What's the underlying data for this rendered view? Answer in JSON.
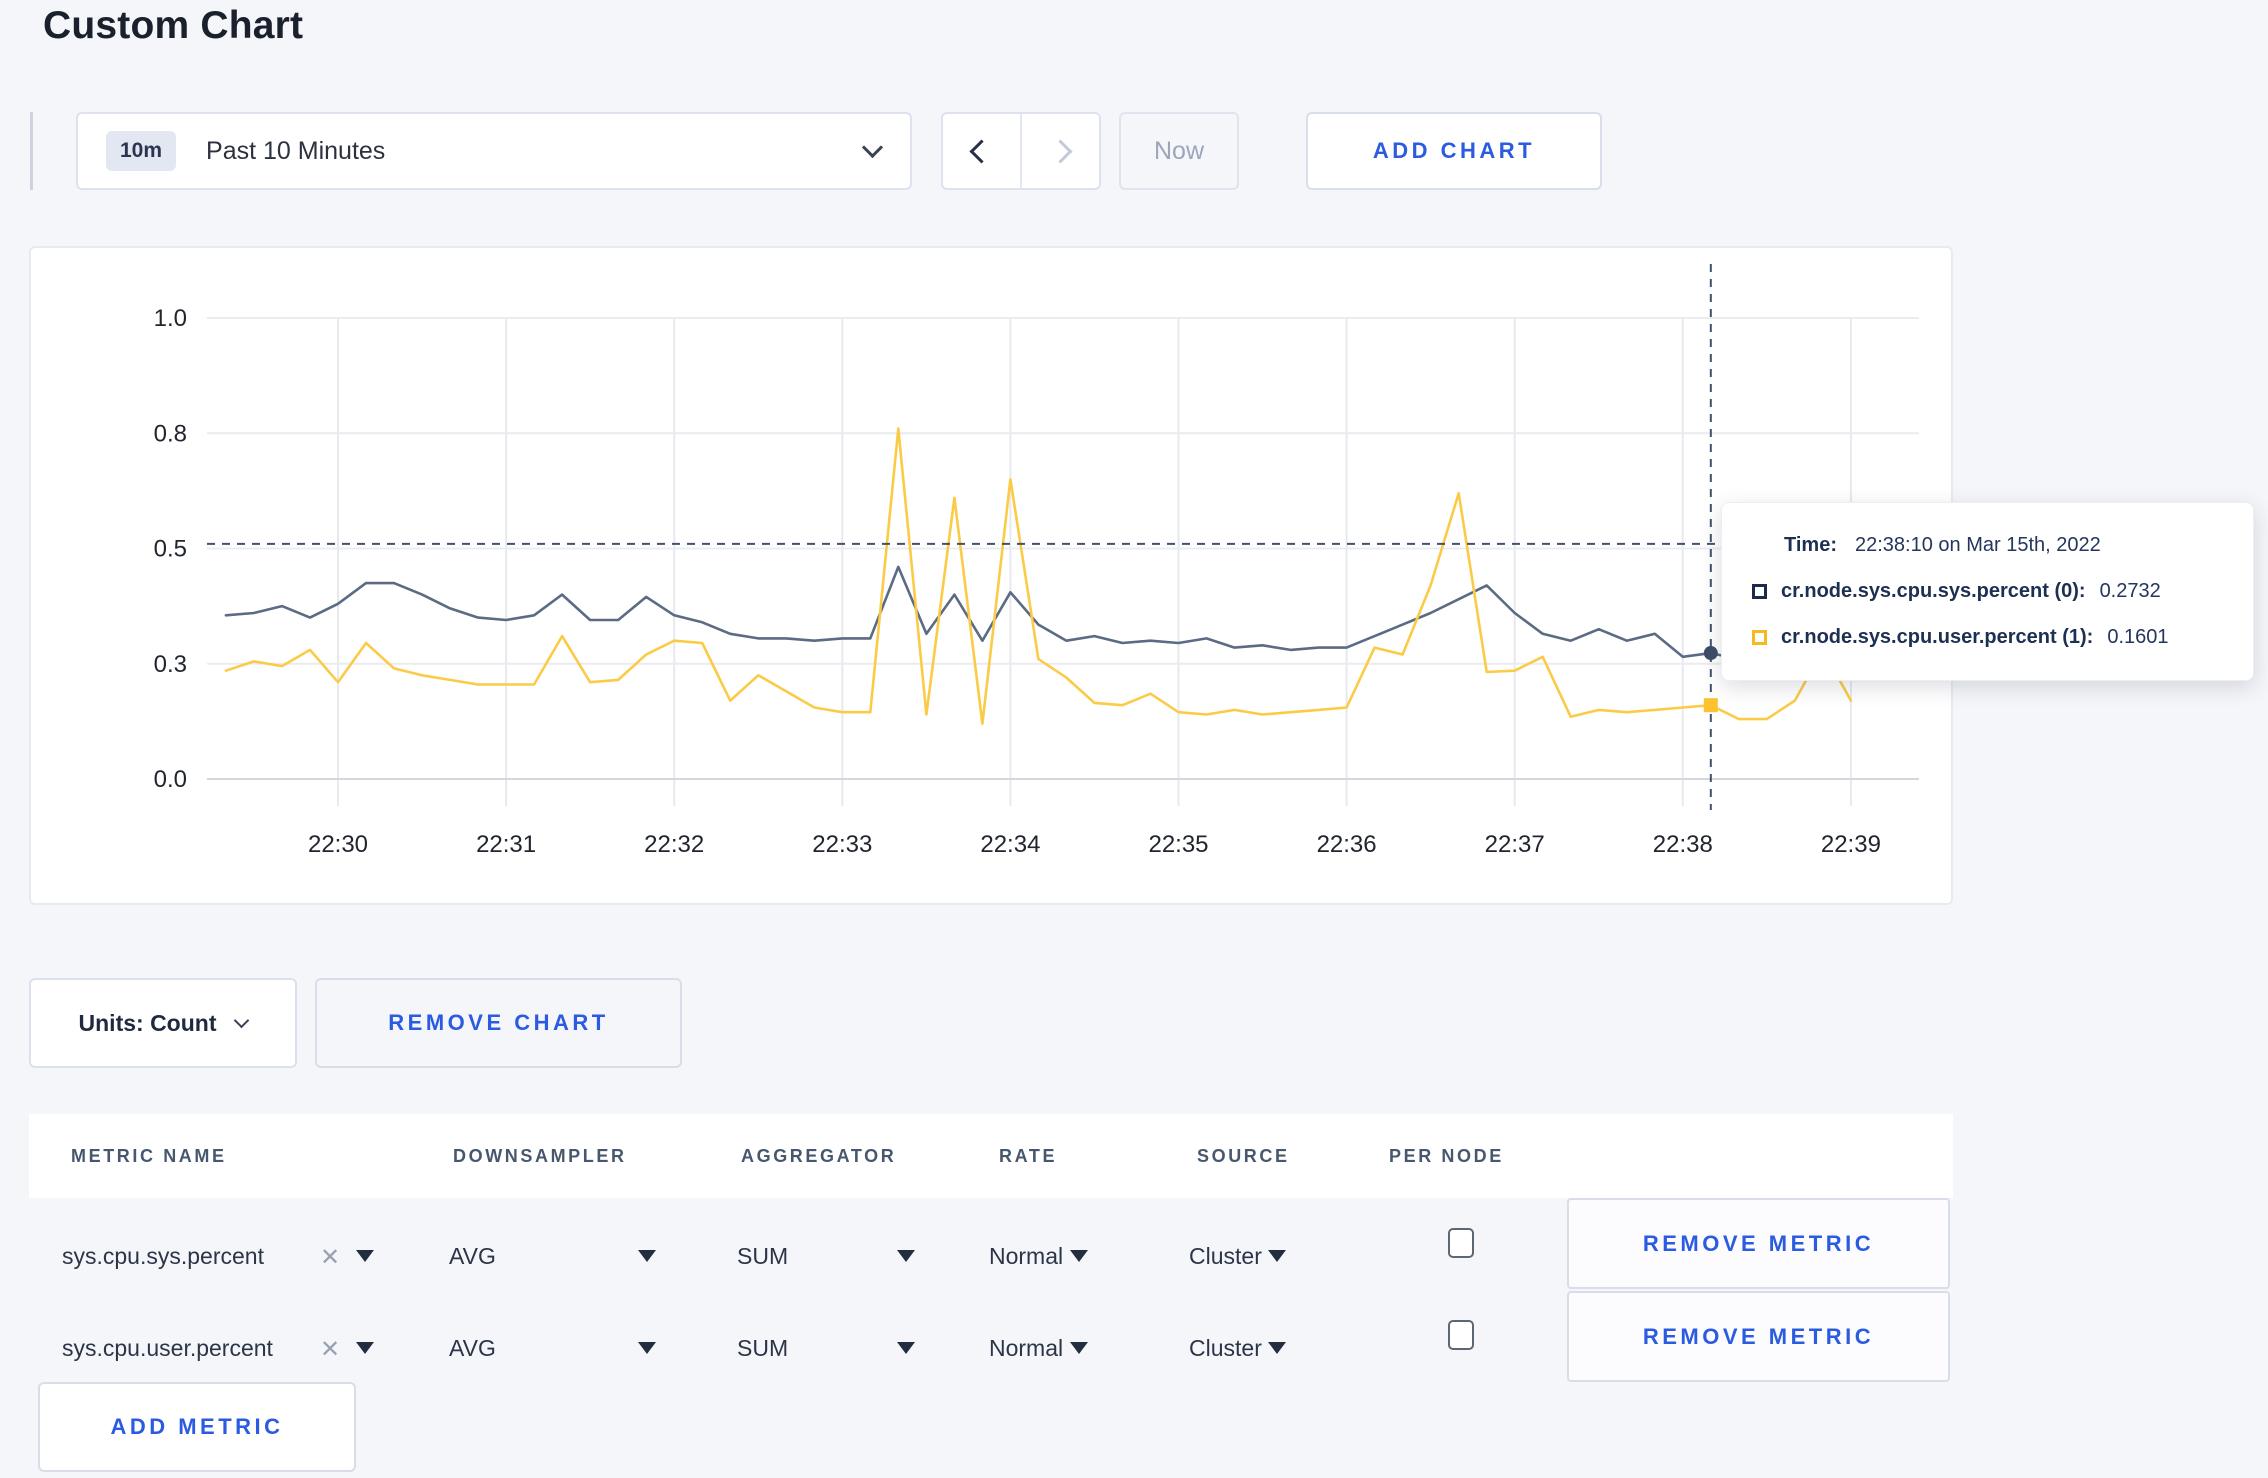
{
  "page": {
    "title": "Custom Chart",
    "background": "#f5f6fa",
    "accent_blue": "#2b5be0"
  },
  "toolbar": {
    "time_range": {
      "badge": "10m",
      "label": "Past 10 Minutes"
    },
    "now_label": "Now",
    "add_chart_label": "ADD CHART"
  },
  "chart_data": {
    "type": "line",
    "title": "",
    "xlabel": "",
    "ylabel": "",
    "ylim": [
      0,
      1
    ],
    "grid": true,
    "legend_position": "tooltip",
    "x_ticks": [
      "22:30",
      "22:31",
      "22:32",
      "22:33",
      "22:34",
      "22:35",
      "22:36",
      "22:37",
      "22:38",
      "22:39"
    ],
    "y_ticks": [
      {
        "v": 0,
        "label": "0.0"
      },
      {
        "v": 0.25,
        "label": "0.3"
      },
      {
        "v": 0.5,
        "label": "0.5"
      },
      {
        "v": 0.75,
        "label": "0.8"
      },
      {
        "v": 1,
        "label": "1.0"
      }
    ],
    "start_sec": -40,
    "step_sec": 10,
    "crosshair": {
      "index": 53,
      "time": "22:38:10",
      "hline_value": 0.51
    },
    "series": [
      {
        "name": "cr.node.sys.cpu.sys.percent (0)",
        "color": "#5b6b84",
        "marker_color": "#3e4d68",
        "values": [
          0.355,
          0.36,
          0.375,
          0.35,
          0.38,
          0.425,
          0.425,
          0.4,
          0.37,
          0.35,
          0.345,
          0.355,
          0.4,
          0.345,
          0.345,
          0.395,
          0.355,
          0.34,
          0.315,
          0.305,
          0.305,
          0.3,
          0.305,
          0.305,
          0.46,
          0.315,
          0.4,
          0.3,
          0.405,
          0.335,
          0.3,
          0.31,
          0.295,
          0.3,
          0.295,
          0.305,
          0.285,
          0.29,
          0.28,
          0.285,
          0.285,
          0.31,
          0.335,
          0.36,
          0.39,
          0.42,
          0.36,
          0.315,
          0.3,
          0.325,
          0.3,
          0.315,
          0.265,
          0.2732,
          0.26,
          0.295,
          0.3,
          0.31,
          0.3
        ]
      },
      {
        "name": "cr.node.sys.cpu.user.percent (1)",
        "color": "#fbcb47",
        "marker_color": "#fcc230",
        "values": [
          0.235,
          0.255,
          0.245,
          0.28,
          0.21,
          0.295,
          0.24,
          0.225,
          0.215,
          0.205,
          0.205,
          0.205,
          0.31,
          0.21,
          0.215,
          0.27,
          0.3,
          0.295,
          0.17,
          0.225,
          0.19,
          0.155,
          0.145,
          0.145,
          0.76,
          0.14,
          0.61,
          0.12,
          0.65,
          0.26,
          0.22,
          0.165,
          0.16,
          0.185,
          0.145,
          0.14,
          0.15,
          0.14,
          0.145,
          0.15,
          0.155,
          0.285,
          0.27,
          0.42,
          0.62,
          0.232,
          0.235,
          0.265,
          0.135,
          0.15,
          0.145,
          0.15,
          0.155,
          0.1601,
          0.13,
          0.13,
          0.17,
          0.28,
          0.17
        ]
      }
    ]
  },
  "tooltip": {
    "time_label": "Time:",
    "time_value": "22:38:10 on Mar 15th, 2022",
    "series": [
      {
        "name": "cr.node.sys.cpu.sys.percent (0):",
        "value": "0.2732"
      },
      {
        "name": "cr.node.sys.cpu.user.percent (1):",
        "value": "0.1601"
      }
    ]
  },
  "units_bar": {
    "units_label": "Units: Count",
    "remove_chart_label": "REMOVE CHART"
  },
  "metrics_table": {
    "columns": [
      "METRIC NAME",
      "DOWNSAMPLER",
      "AGGREGATOR",
      "RATE",
      "SOURCE",
      "PER NODE"
    ],
    "clear_icon": "✕",
    "rows": [
      {
        "metric": "sys.cpu.sys.percent",
        "downsampler": "AVG",
        "aggregator": "SUM",
        "rate": "Normal",
        "source": "Cluster",
        "per_node_checked": false
      },
      {
        "metric": "sys.cpu.user.percent",
        "downsampler": "AVG",
        "aggregator": "SUM",
        "rate": "Normal",
        "source": "Cluster",
        "per_node_checked": false
      }
    ],
    "remove_metric_label": "REMOVE METRIC",
    "add_metric_label": "ADD METRIC"
  }
}
